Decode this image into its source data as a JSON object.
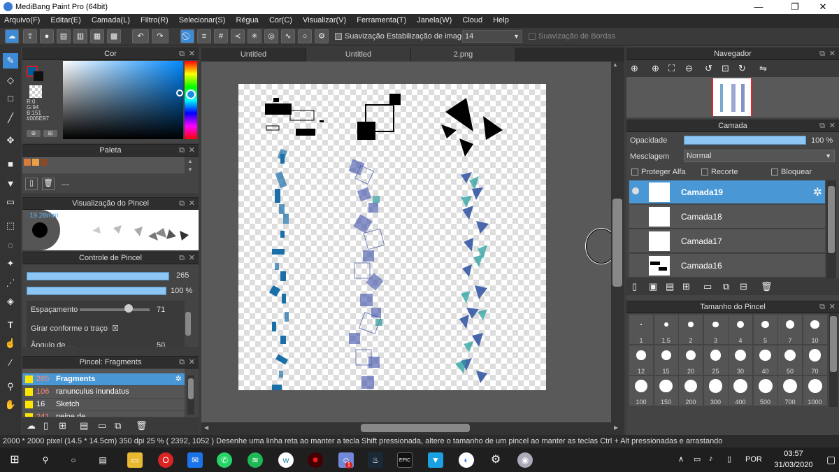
{
  "window": {
    "title": "MediBang Paint Pro (64bit)",
    "min": "—",
    "max": "❐",
    "close": "✕"
  },
  "menu": [
    "Arquivo(F)",
    "Editar(E)",
    "Camada(L)",
    "Filtro(R)",
    "Selecionar(S)",
    "Régua",
    "Cor(C)",
    "Visualizar(V)",
    "Ferramenta(T)",
    "Janela(W)",
    "Cloud",
    "Help"
  ],
  "toolbar": {
    "smoothing_label": "Suavização",
    "stabilization_label": "Estabilização de imagens",
    "stabilization_value": "14",
    "edge_smoothing_label": "Suavização de Bordas"
  },
  "color_panel": {
    "title": "Cor",
    "r": "R:0",
    "g": "G:94",
    "b": "B:151",
    "hex": "#005E97",
    "current_color": "#005E97"
  },
  "palette_panel": {
    "title": "Paleta",
    "empty_label": "---",
    "swatches": [
      "#d97b3a",
      "#e8a04a",
      "#8a4a2a"
    ]
  },
  "brush_preview": {
    "title": "Visualização do Pincel",
    "size_label": "19.28mm"
  },
  "brush_control": {
    "title": "Controle de Pincel",
    "size_value": "265",
    "opacity_value": "100 %",
    "spacing_label": "Espaçamento",
    "spacing_value": "71",
    "rotate_label": "Girar conforme o traço",
    "rotate_check": "☒",
    "angle_label": "Ângulo de ...",
    "angle_value": "50"
  },
  "brush_list": {
    "title": "Pincel: Fragments",
    "items": [
      {
        "num": "265",
        "name": "Fragments"
      },
      {
        "num": "106",
        "name": "ranunculus inundatus"
      },
      {
        "num": "16",
        "name": "Sketch"
      },
      {
        "num": "241",
        "name": "peine de ..."
      }
    ]
  },
  "tabs": [
    "Untitled",
    "Untitled",
    "2.png"
  ],
  "navigator": {
    "title": "Navegador"
  },
  "layers": {
    "title": "Camada",
    "opacity_label": "Opacidade",
    "opacity_value": "100 %",
    "blend_label": "Mesclagem",
    "blend_value": "Normal",
    "protect_alpha": "Proteger Alfa",
    "clip": "Recorte",
    "lock": "Bloquear",
    "items": [
      "Camada19",
      "Camada18",
      "Camada17",
      "Camada16"
    ]
  },
  "brush_size": {
    "title": "Tamanho do Pincel",
    "sizes": [
      "1",
      "1.5",
      "2",
      "3",
      "4",
      "5",
      "7",
      "10",
      "12",
      "15",
      "20",
      "25",
      "30",
      "40",
      "50",
      "70",
      "100",
      "150",
      "200",
      "300",
      "400",
      "500",
      "700",
      "1000"
    ]
  },
  "status": "2000 * 2000 pixel   (14.5 * 14.5cm)   350 dpi   25 %   ( 2392, 1052 )   Desenhe uma linha reta ao manter a tecla Shift pressionada, altere o tamanho de um pincel ao manter as teclas Ctrl + Alt pressionadas e arrastando",
  "taskbar": {
    "lang": "POR",
    "time": "03:57",
    "date": "31/03/2020",
    "epic": "EPIC",
    "badge": "1"
  }
}
